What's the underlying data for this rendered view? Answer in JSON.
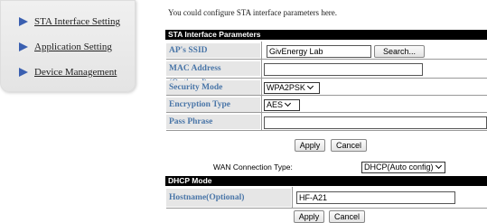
{
  "sidebar": {
    "items": [
      {
        "label": "STA Interface Setting",
        "icon": "arrow-right-icon"
      },
      {
        "label": "Application Setting",
        "icon": "arrow-right-icon"
      },
      {
        "label": "Device Management",
        "icon": "arrow-right-icon"
      }
    ]
  },
  "intro": "You could configure STA interface parameters here.",
  "sta_params": {
    "header": "STA Interface Parameters",
    "ssid_label": "AP's SSID",
    "ssid_value": "GivEnergy Lab",
    "search_label": "Search...",
    "mac_label": "MAC Address (Optional)",
    "mac_value": "",
    "security_label": "Security Mode",
    "security_value": "WPA2PSK",
    "encryption_label": "Encryption Type",
    "encryption_value": "AES",
    "pass_label": "Pass Phrase",
    "pass_value": ""
  },
  "buttons": {
    "apply": "Apply",
    "cancel": "Cancel"
  },
  "wan": {
    "label": "WAN Connection Type:",
    "value": "DHCP(Auto config)"
  },
  "dhcp": {
    "header": "DHCP Mode",
    "hostname_label": "Hostname(Optional)",
    "hostname_value": "HF-A21"
  },
  "colors": {
    "label_text": "#4a76a8",
    "label_bg": "#e6e6e6",
    "header_bg": "#000000",
    "nav_arrow": "#3a5fb0"
  }
}
